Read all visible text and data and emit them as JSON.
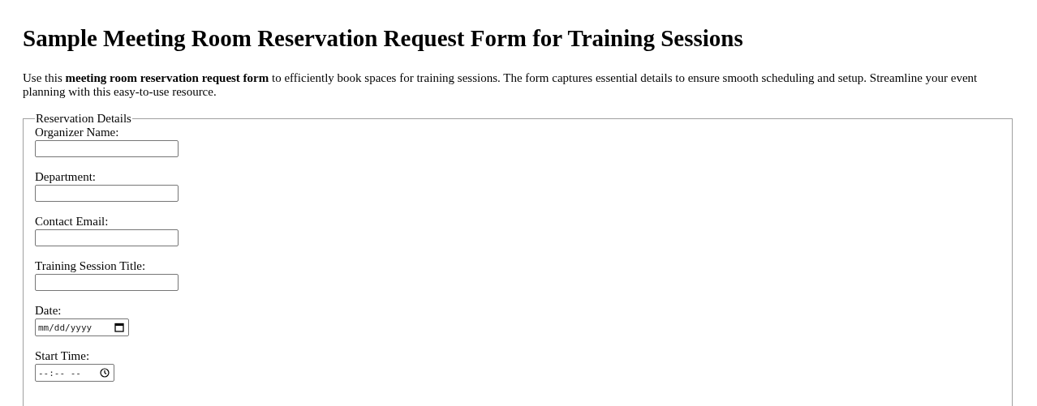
{
  "title": "Sample Meeting Room Reservation Request Form for Training Sessions",
  "intro": "Use this **meeting room reservation request form** to efficiently book spaces for training sessions. The form captures essential details to ensure smooth scheduling and setup. Streamline your event planning with this easy-to-use resource.",
  "fieldset": {
    "legend": "Reservation Details",
    "fields": [
      {
        "label": "Organizer Name:",
        "kind": "text"
      },
      {
        "label": "Department:",
        "kind": "text"
      },
      {
        "label": "Contact Email:",
        "kind": "text"
      },
      {
        "label": "Training Session Title:",
        "kind": "text"
      },
      {
        "label": "Date:",
        "kind": "date",
        "placeholder": "mm/dd/yyyy"
      },
      {
        "label": "Start Time:",
        "kind": "time",
        "placeholder": "--:-- --"
      }
    ]
  }
}
